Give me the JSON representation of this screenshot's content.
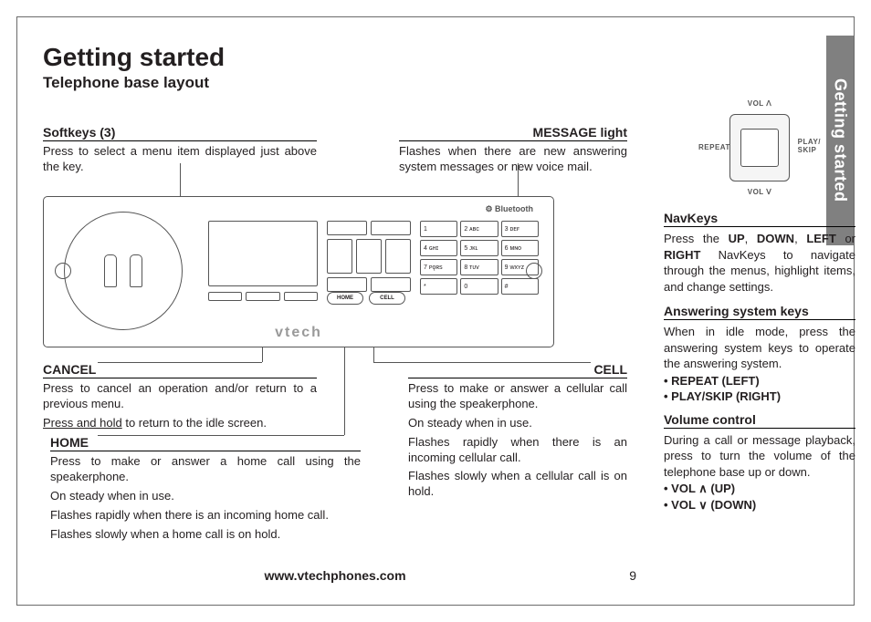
{
  "side_tab": "Getting started",
  "h1": "Getting started",
  "h2": "Telephone base layout",
  "brand": "vtech",
  "bluetooth": "⚙ Bluetooth",
  "callouts": {
    "softkeys": {
      "title": "Softkeys (3)",
      "p1": "Press to select a menu item displayed just above the key."
    },
    "msglight": {
      "title": "MESSAGE light",
      "p1": "Flashes when there are new answering system messages or new voice mail."
    },
    "cancel": {
      "title": "CANCEL",
      "p1": "Press to cancel an operation and/or return to a previous menu.",
      "p2_u": "Press and hold",
      "p2_rest": " to return to the idle screen."
    },
    "cell": {
      "title": "CELL",
      "p1": "Press to make or answer a cellular call using the speakerphone.",
      "p2": "On steady when in use.",
      "p3": "Flashes rapidly when there is an incoming cellular call.",
      "p4": "Flashes slowly when a cellular call is on hold."
    },
    "home": {
      "title": "HOME",
      "p1": "Press to make or answer a home call using the speakerphone.",
      "p2": "On steady when in use.",
      "p3": "Flashes rapidly when there is an incoming home call.",
      "p4": "Flashes slowly when a home call is on hold."
    }
  },
  "nav_thumb": {
    "up": "VOL  ᐱ",
    "down": "VOL  ᐯ",
    "left": "REPEAT",
    "right": "PLAY/\nSKIP"
  },
  "right": {
    "navkeys": {
      "title": "NavKeys",
      "text_pre": "Press the ",
      "up": "UP",
      "c1": ", ",
      "down": "DOWN",
      "c2": ", ",
      "left": "LEFT",
      "or": " or ",
      "right": "RIGHT",
      "text_post": " NavKeys to navigate through the menus, highlight items, and change settings."
    },
    "ans": {
      "title": "Answering system keys",
      "text": "When in idle mode, press the answering system keys to operate the answering system.",
      "b1": "• REPEAT (LEFT)",
      "b2": "• PLAY/SKIP (RIGHT)"
    },
    "vol": {
      "title": "Volume control",
      "text": "During a call or message playback, press to turn the volume of the telephone base up or down.",
      "b1_pre": "• VOL  ",
      "b1_post": " (UP)",
      "b2_pre": "• VOL  ",
      "b2_post": " (DOWN)"
    }
  },
  "home_btn": "HOME",
  "cell_btn": "CELL",
  "footer_url": "www.vtechphones.com",
  "footer_page": "9"
}
